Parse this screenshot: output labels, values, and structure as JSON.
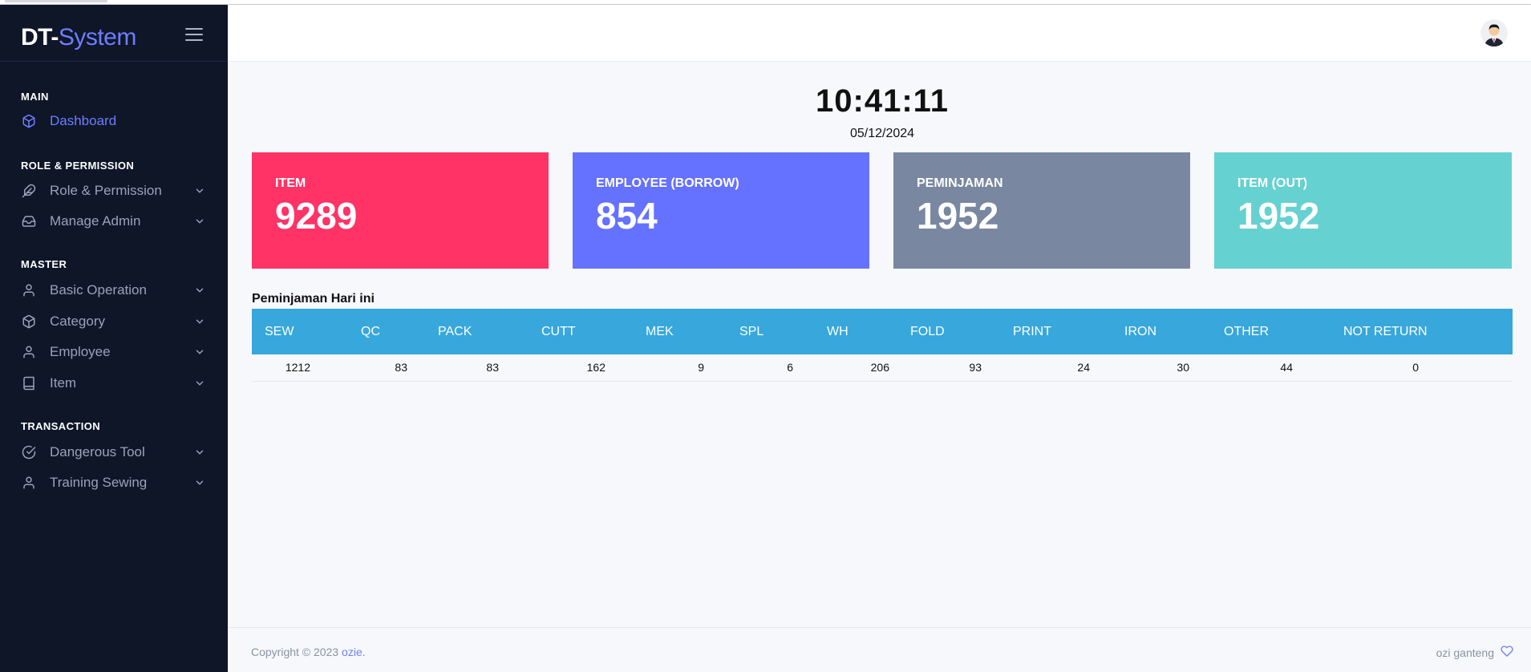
{
  "brand": {
    "part1": "DT-",
    "part2": "System"
  },
  "sidebar": {
    "sections": [
      {
        "heading": "MAIN"
      },
      {
        "heading": "ROLE & PERMISSION"
      },
      {
        "heading": "MASTER"
      },
      {
        "heading": "TRANSACTION"
      }
    ],
    "items": [
      {
        "label": "Dashboard",
        "icon": "cube-icon",
        "active": true
      },
      {
        "label": "Role & Permission",
        "icon": "feather-icon"
      },
      {
        "label": "Manage Admin",
        "icon": "inbox-icon"
      },
      {
        "label": "Basic Operation",
        "icon": "user-icon"
      },
      {
        "label": "Category",
        "icon": "cube-icon"
      },
      {
        "label": "Employee",
        "icon": "user-icon"
      },
      {
        "label": "Item",
        "icon": "book-icon"
      },
      {
        "label": "Dangerous Tool",
        "icon": "check-circle-icon"
      },
      {
        "label": "Training Sewing",
        "icon": "user-icon"
      }
    ]
  },
  "header": {
    "avatar": "avatar-icon"
  },
  "clock": {
    "time": "10:41:11",
    "date": "05/12/2024"
  },
  "cards": [
    {
      "title": "ITEM",
      "value": "9289",
      "color": "#ff3366"
    },
    {
      "title": "EMPLOYEE (BORROW)",
      "value": "854",
      "color": "#6571ff"
    },
    {
      "title": "PEMINJAMAN",
      "value": "1952",
      "color": "#7987a1"
    },
    {
      "title": "ITEM (OUT)",
      "value": "1952",
      "color": "#66d1d1"
    }
  ],
  "table": {
    "title": "Peminjaman Hari ini",
    "headers": [
      "SEW",
      "QC",
      "PACK",
      "CUTT",
      "MEK",
      "SPL",
      "WH",
      "FOLD",
      "PRINT",
      "IRON",
      "OTHER",
      "NOT RETURN"
    ],
    "rows": [
      [
        "1212",
        "83",
        "83",
        "162",
        "9",
        "6",
        "206",
        "93",
        "24",
        "30",
        "44",
        "0"
      ]
    ]
  },
  "footer": {
    "copyright": "Copyright © 2023",
    "author": "ozie.",
    "right_text": "ozi ganteng"
  },
  "colors": {
    "sidebar": "#0e1628",
    "accent": "#6e7dff",
    "table_header": "#37a7dc"
  }
}
